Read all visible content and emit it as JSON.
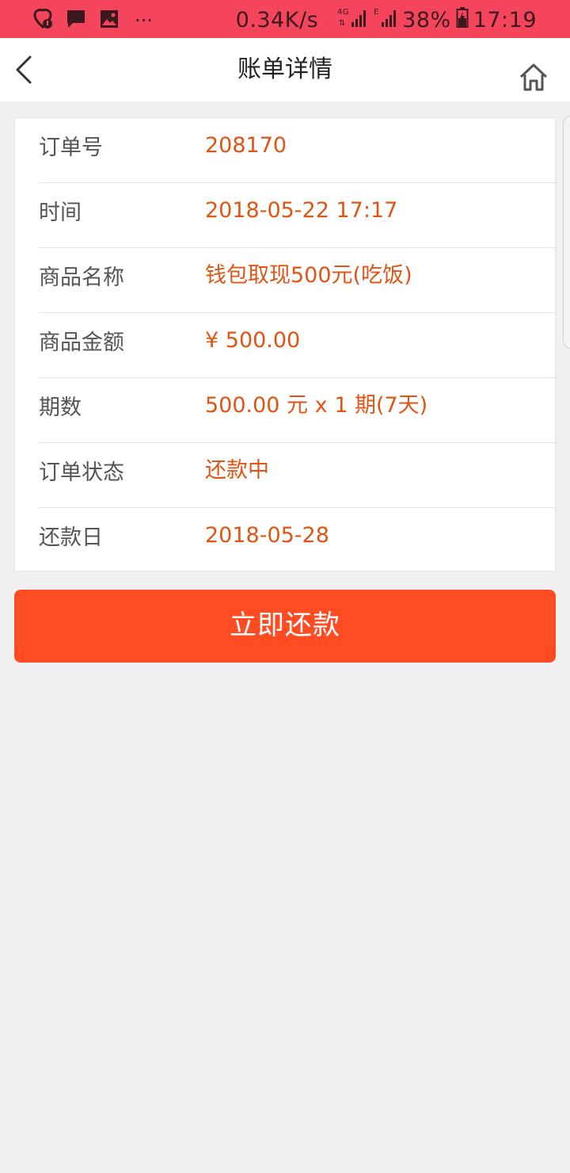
{
  "status_bar": {
    "network_speed": "0.34K/s",
    "battery": "38%",
    "time": "17:19",
    "more": "···"
  },
  "header": {
    "title": "账单详情"
  },
  "details": [
    {
      "label": "订单号",
      "value": "208170"
    },
    {
      "label": "时间",
      "value": "2018-05-22 17:17"
    },
    {
      "label": "商品名称",
      "value": "钱包取现500元(吃饭)"
    },
    {
      "label": "商品金额",
      "value": "¥ 500.00"
    },
    {
      "label": "期数",
      "value": "500.00 元 x 1 期(7天)"
    },
    {
      "label": "订单状态",
      "value": "还款中"
    },
    {
      "label": "还款日",
      "value": "2018-05-28"
    }
  ],
  "actions": {
    "repay_label": "立即还款"
  },
  "colors": {
    "status_bar": "#f5455c",
    "value_text": "#e05514",
    "button": "#ff4c22",
    "background": "#f0f0f3"
  }
}
